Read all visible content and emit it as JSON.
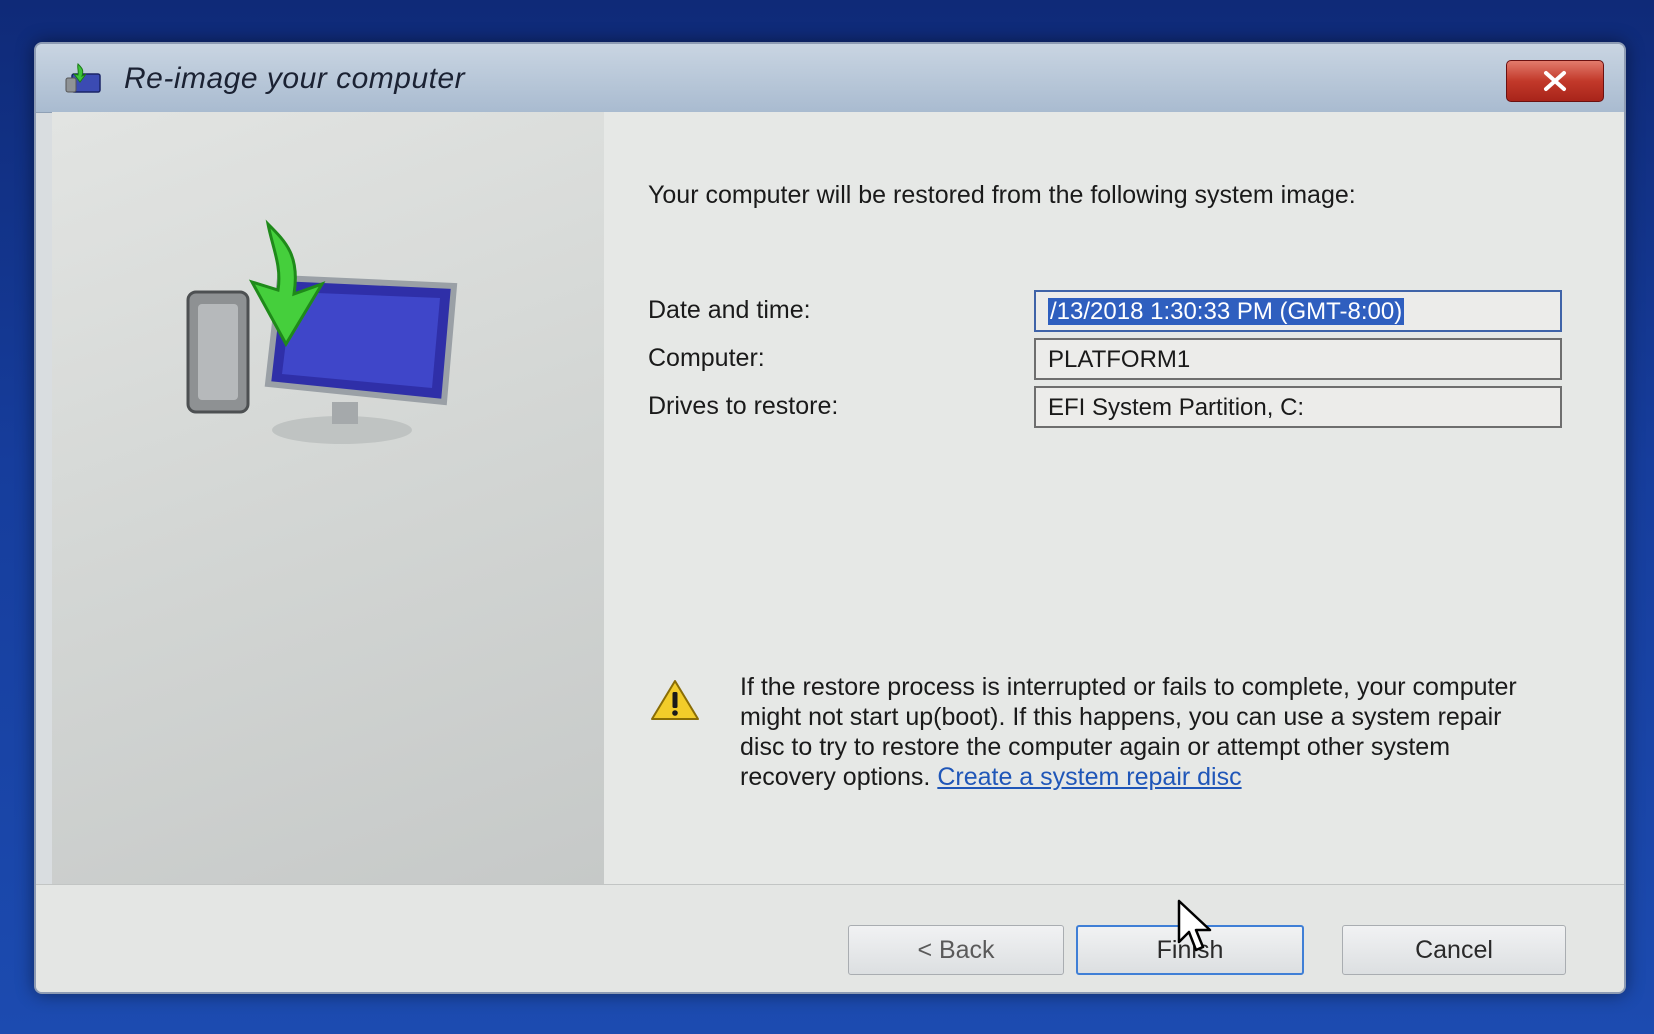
{
  "window": {
    "title": "Re-image your computer",
    "close_icon": "close-icon"
  },
  "main": {
    "intro": "Your computer will be restored from the following system image:",
    "fields": {
      "date_label": "Date and time:",
      "date_value": "/13/2018 1:30:33 PM (GMT-8:00)",
      "computer_label": "Computer:",
      "computer_value": "PLATFORM1",
      "drives_label": "Drives to restore:",
      "drives_value": "EFI System Partition, C:"
    }
  },
  "warning": {
    "icon": "warning-icon",
    "text": "If the restore process is interrupted or fails to complete, your computer might not start up(boot). If this happens, you can use a system repair disc to try to restore the computer again or attempt other system recovery options.",
    "link": "Create a system repair disc"
  },
  "buttons": {
    "back": "< Back",
    "finish": "Finish",
    "cancel": "Cancel"
  },
  "colors": {
    "desktop": "#163d9c",
    "close_button": "#c2392a",
    "selection": "#2f5fbf",
    "link": "#1f56b8",
    "focus_border": "#3f7fd6"
  }
}
